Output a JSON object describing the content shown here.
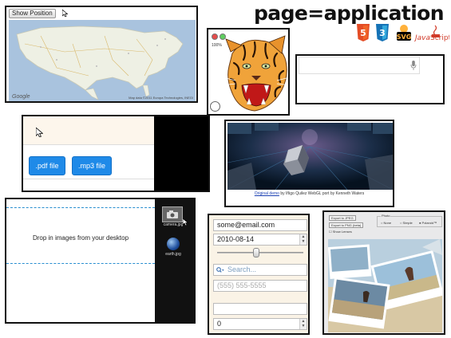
{
  "header": {
    "title": "page=application"
  },
  "logos": {
    "html5": "HTML",
    "css3": "CSS",
    "svg": "SVG",
    "javascript": "JavaScript"
  },
  "map_demo": {
    "button_label": "Show Position",
    "google_label": "Google",
    "credit": "Map data ©2011 Europa Technologies, INEGI"
  },
  "svg_demo": {
    "zoom": "100%"
  },
  "file_demo": {
    "pdf_button": ".pdf file",
    "mp3_button": ".mp3 file"
  },
  "webgl_demo": {
    "caption_link": "Original demo",
    "caption_text": " by Iñigo Quilez WebGL port by Kenneth Waters"
  },
  "drop_demo": {
    "message": "Drop in images from your desktop",
    "thumbnails": [
      {
        "label": "camera.jpg"
      },
      {
        "label": "earth.jpg"
      }
    ]
  },
  "form_demo": {
    "email": "some@email.com",
    "date": "2010-08-14",
    "search_placeholder": "Search...",
    "tel_placeholder": "(555) 555-5555",
    "number": "0",
    "slider_value": 0.45
  },
  "camera_demo": {
    "export_jpeg": "Export to JPEG",
    "export_png": "Export to PNG (beta)",
    "show_lenses": "Show Lenses",
    "photo_label": "Photo",
    "options": [
      "None",
      "Simple",
      "Polaroid™"
    ]
  },
  "colors": {
    "accent_blue": "#1f8ae8",
    "dash_blue": "#2a8fd0",
    "dark": "#111111"
  }
}
